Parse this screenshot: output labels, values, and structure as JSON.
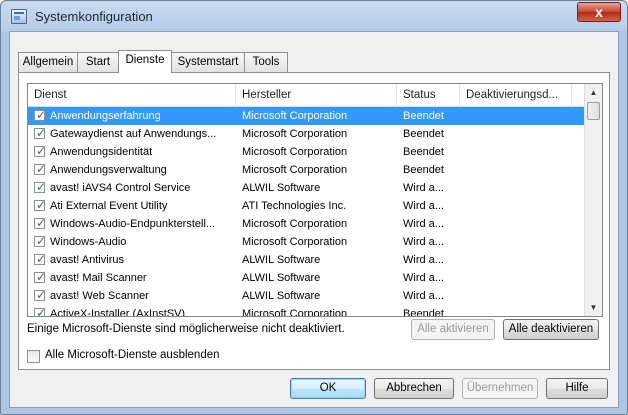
{
  "window": {
    "title": "Systemkonfiguration",
    "close_label": "x"
  },
  "tabs": [
    {
      "label": "Allgemein"
    },
    {
      "label": "Start"
    },
    {
      "label": "Dienste"
    },
    {
      "label": "Systemstart"
    },
    {
      "label": "Tools"
    }
  ],
  "active_tab": "Dienste",
  "table": {
    "columns": [
      "Dienst",
      "Hersteller",
      "Status",
      "Deaktivierungsd..."
    ],
    "rows": [
      {
        "checked": true,
        "name": "Anwendungserfahrung",
        "vendor": "Microsoft Corporation",
        "status": "Beendet",
        "date": ""
      },
      {
        "checked": true,
        "name": "Gatewaydienst auf Anwendungs...",
        "vendor": "Microsoft Corporation",
        "status": "Beendet",
        "date": ""
      },
      {
        "checked": true,
        "name": "Anwendungsidentität",
        "vendor": "Microsoft Corporation",
        "status": "Beendet",
        "date": ""
      },
      {
        "checked": true,
        "name": "Anwendungsverwaltung",
        "vendor": "Microsoft Corporation",
        "status": "Beendet",
        "date": ""
      },
      {
        "checked": true,
        "name": "avast! iAVS4 Control Service",
        "vendor": "ALWIL Software",
        "status": "Wird a...",
        "date": ""
      },
      {
        "checked": true,
        "name": "Ati External Event Utility",
        "vendor": "ATI Technologies Inc.",
        "status": "Wird a...",
        "date": ""
      },
      {
        "checked": true,
        "name": "Windows-Audio-Endpunkterstell...",
        "vendor": "Microsoft Corporation",
        "status": "Wird a...",
        "date": ""
      },
      {
        "checked": true,
        "name": "Windows-Audio",
        "vendor": "Microsoft Corporation",
        "status": "Wird a...",
        "date": ""
      },
      {
        "checked": true,
        "name": "avast! Antivirus",
        "vendor": "ALWIL Software",
        "status": "Wird a...",
        "date": ""
      },
      {
        "checked": true,
        "name": "avast! Mail Scanner",
        "vendor": "ALWIL Software",
        "status": "Wird a...",
        "date": ""
      },
      {
        "checked": true,
        "name": "avast! Web Scanner",
        "vendor": "ALWIL Software",
        "status": "Wird a...",
        "date": ""
      },
      {
        "checked": true,
        "name": "ActiveX-Installer (AxInstSV)",
        "vendor": "Microsoft Corporation",
        "status": "Beendet",
        "date": ""
      }
    ],
    "selected_row": "Anwendungserfahrung"
  },
  "note": "Einige Microsoft-Dienste sind möglicherweise nicht deaktiviert.",
  "buttons": {
    "enable_all": "Alle aktivieren",
    "disable_all": "Alle deaktivieren",
    "ok": "OK",
    "cancel": "Abbrechen",
    "apply": "Übernehmen",
    "help": "Hilfe"
  },
  "hide_ms": {
    "label": "Alle Microsoft-Dienste ausblenden",
    "checked": false
  },
  "icons": {
    "app": "msconfig-icon",
    "check": "✓",
    "scroll_up": "▲",
    "scroll_down": "▼"
  }
}
